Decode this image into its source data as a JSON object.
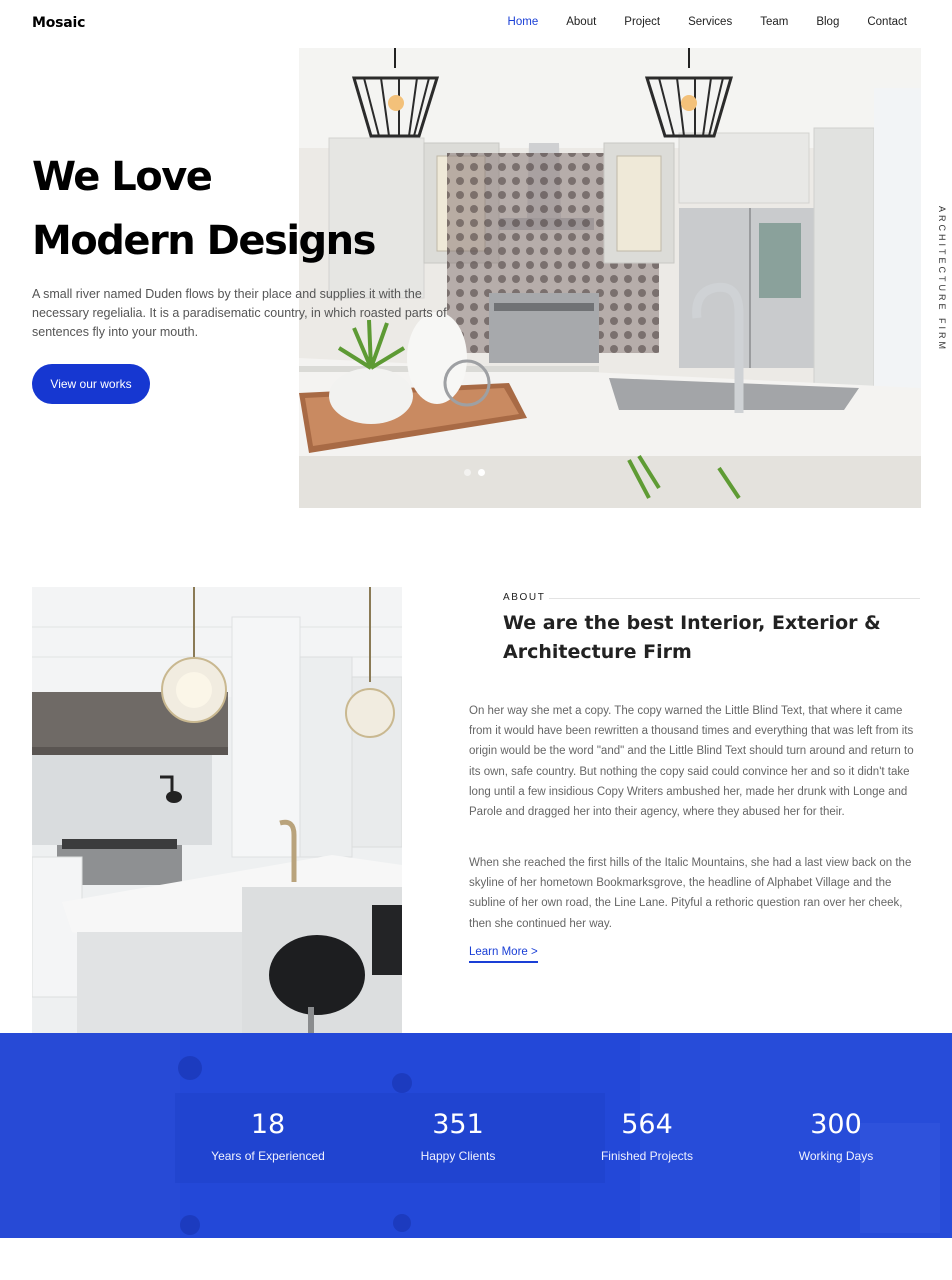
{
  "nav": {
    "logo": "Mosaic",
    "items": [
      {
        "label": "Home",
        "active": true
      },
      {
        "label": "About"
      },
      {
        "label": "Project"
      },
      {
        "label": "Services"
      },
      {
        "label": "Team"
      },
      {
        "label": "Blog"
      },
      {
        "label": "Contact"
      }
    ]
  },
  "hero": {
    "title_line1": "We Love",
    "title_line2": "Modern Designs",
    "text": "A small river named Duden flows by their place and supplies it with the necessary regelialia. It is a paradisematic country, in which roasted parts of sentences fly into your mouth.",
    "button": "View our works",
    "side_text": "ARCHITECTURE FIRM",
    "slide_count": 2,
    "active_slide": 2
  },
  "about": {
    "label": "ABOUT",
    "heading": "We are the best Interior, Exterior & Architecture Firm",
    "paragraph1": "On her way she met a copy. The copy warned the Little Blind Text, that where it came from it would have been rewritten a thousand times and everything that was left from its origin would be the word \"and\" and the Little Blind Text should turn around and return to its own, safe country. But nothing the copy said could convince her and so it didn't take long until a few insidious Copy Writers ambushed her, made her drunk with Longe and Parole and dragged her into their agency, where they abused her for their.",
    "paragraph2": "When she reached the first hills of the Italic Mountains, she had a last view back on the skyline of her hometown Bookmarksgrove, the headline of Alphabet Village and the subline of her own road, the Line Lane. Pityful a rethoric question ran over her cheek, then she continued her way.",
    "link": "Learn More >"
  },
  "stats": {
    "items": [
      {
        "number": "18",
        "label": "Years of Experienced"
      },
      {
        "number": "351",
        "label": "Happy Clients"
      },
      {
        "number": "564",
        "label": "Finished Projects"
      },
      {
        "number": "300",
        "label": "Working Days"
      }
    ]
  },
  "colors": {
    "accent": "#1637d1",
    "stats_bg": "#2348d8"
  }
}
